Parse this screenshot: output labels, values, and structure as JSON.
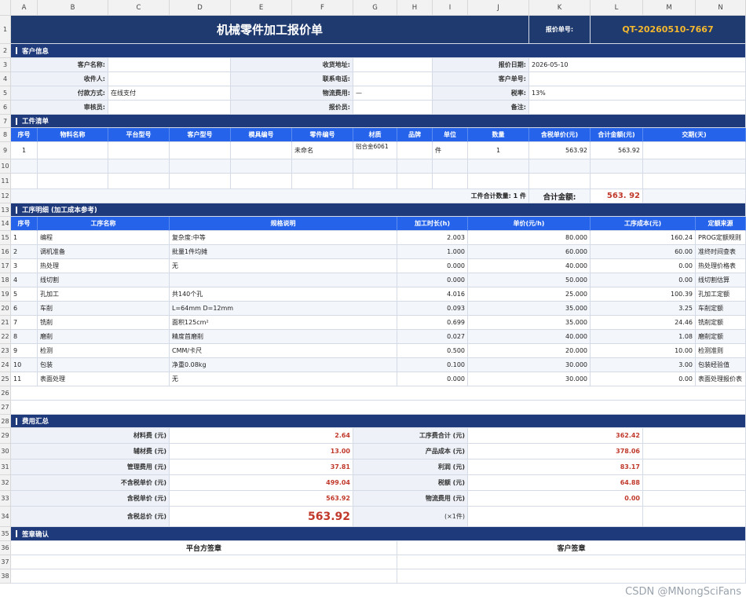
{
  "columns": [
    "A",
    "B",
    "C",
    "D",
    "E",
    "F",
    "G",
    "H",
    "I",
    "J",
    "K",
    "L",
    "M",
    "N"
  ],
  "rows": [
    "1",
    "2",
    "3",
    "4",
    "5",
    "6",
    "7",
    "8",
    "9",
    "10",
    "11",
    "12",
    "13",
    "14",
    "15",
    "16",
    "17",
    "18",
    "19",
    "20",
    "21",
    "22",
    "23",
    "24",
    "25",
    "26",
    "27",
    "28",
    "29",
    "30",
    "31",
    "32",
    "33",
    "34",
    "35",
    "36",
    "37",
    "38"
  ],
  "title": "机械零件加工报价单",
  "quote_no_label": "报价单号:",
  "quote_no": "QT-20260510-7667",
  "customer": {
    "section": "客户信息",
    "name_label": "客户名称:",
    "name": "",
    "recipient_label": "收件人:",
    "recipient": "",
    "payment_label": "付款方式:",
    "payment": "在线支付",
    "reviewer_label": "审核员:",
    "reviewer": "",
    "address_label": "收货地址:",
    "address": "",
    "phone_label": "联系电话:",
    "phone": "",
    "logistics_label": "物流费用:",
    "logistics": "—",
    "quoter_label": "报价员:",
    "quoter": "",
    "date_label": "报价日期:",
    "date": "2026-05-10",
    "cust_no_label": "客户单号:",
    "cust_no": "",
    "tax_label": "税率:",
    "tax": "13%",
    "remark_label": "备注:",
    "remark": ""
  },
  "parts": {
    "section": "工件清单",
    "headers": [
      "序号",
      "物料名称",
      "平台型号",
      "客户型号",
      "模具编号",
      "零件编号",
      "材质",
      "品牌",
      "单位",
      "数量",
      "含税单价(元)",
      "合计金额(元)",
      "交期(天)"
    ],
    "rows": [
      [
        "1",
        "",
        "",
        "",
        "",
        "未命名",
        "铝合金6061",
        "",
        "件",
        "1",
        "563.92",
        "563.92",
        ""
      ]
    ],
    "total_qty_label": "工件合计数量:",
    "total_qty": "1 件",
    "total_amount_label": "合计金额:",
    "total_amount": "563. 92"
  },
  "process": {
    "section": "工序明细 (加工成本参考)",
    "headers": [
      "序号",
      "工序名称",
      "规格说明",
      "加工时长(h)",
      "单价(元/h)",
      "工序成本(元)",
      "定额来源"
    ],
    "rows": [
      [
        "1",
        "编程",
        "复杂度:中等",
        "2.003",
        "80.000",
        "160.24",
        "PROG定额规则"
      ],
      [
        "2",
        "调机准备",
        "批量1件均摊",
        "1.000",
        "60.000",
        "60.00",
        "准终时间查表"
      ],
      [
        "3",
        "热处理",
        "无",
        "0.000",
        "40.000",
        "0.00",
        "热处理价格表"
      ],
      [
        "4",
        "线切割",
        "",
        "0.000",
        "50.000",
        "0.00",
        "线切割估算"
      ],
      [
        "5",
        "孔加工",
        "共140个孔",
        "4.016",
        "25.000",
        "100.39",
        "孔加工定额"
      ],
      [
        "6",
        "车削",
        "L=64mm D=12mm",
        "0.093",
        "35.000",
        "3.25",
        "车削定额"
      ],
      [
        "7",
        "铣削",
        "面积125cm²",
        "0.699",
        "35.000",
        "24.46",
        "铣削定额"
      ],
      [
        "8",
        "磨削",
        "精度首磨削",
        "0.027",
        "40.000",
        "1.08",
        "磨削定额"
      ],
      [
        "9",
        "检测",
        "CMM/卡尺",
        "0.500",
        "20.000",
        "10.00",
        "检测准则"
      ],
      [
        "10",
        "包装",
        "净重0.08kg",
        "0.100",
        "30.000",
        "3.00",
        "包装经验值"
      ],
      [
        "11",
        "表面处理",
        "无",
        "0.000",
        "30.000",
        "0.00",
        "表面处理报价表"
      ]
    ]
  },
  "summary": {
    "section": "费用汇总",
    "left": [
      {
        "label": "材料费 (元)",
        "value": "2.64"
      },
      {
        "label": "辅材费 (元)",
        "value": "13.00"
      },
      {
        "label": "管理费用 (元)",
        "value": "37.81"
      },
      {
        "label": "不含税单价 (元)",
        "value": "499.04"
      },
      {
        "label": "含税单价 (元)",
        "value": "563.92"
      },
      {
        "label": "含税总价 (元)",
        "value": "563.92"
      }
    ],
    "right": [
      {
        "label": "工序费合计 (元)",
        "value": "362.42"
      },
      {
        "label": "产品成本 (元)",
        "value": "378.06"
      },
      {
        "label": "利润 (元)",
        "value": "83.17"
      },
      {
        "label": "税额 (元)",
        "value": "64.88"
      },
      {
        "label": "物流费用 (元)",
        "value": "0.00"
      },
      {
        "label": "(×1件)",
        "value": ""
      }
    ]
  },
  "sign": {
    "section": "签章确认",
    "platform": "平台方签章",
    "customer": "客户签章"
  },
  "watermark": "CSDN @MNongSciFans"
}
